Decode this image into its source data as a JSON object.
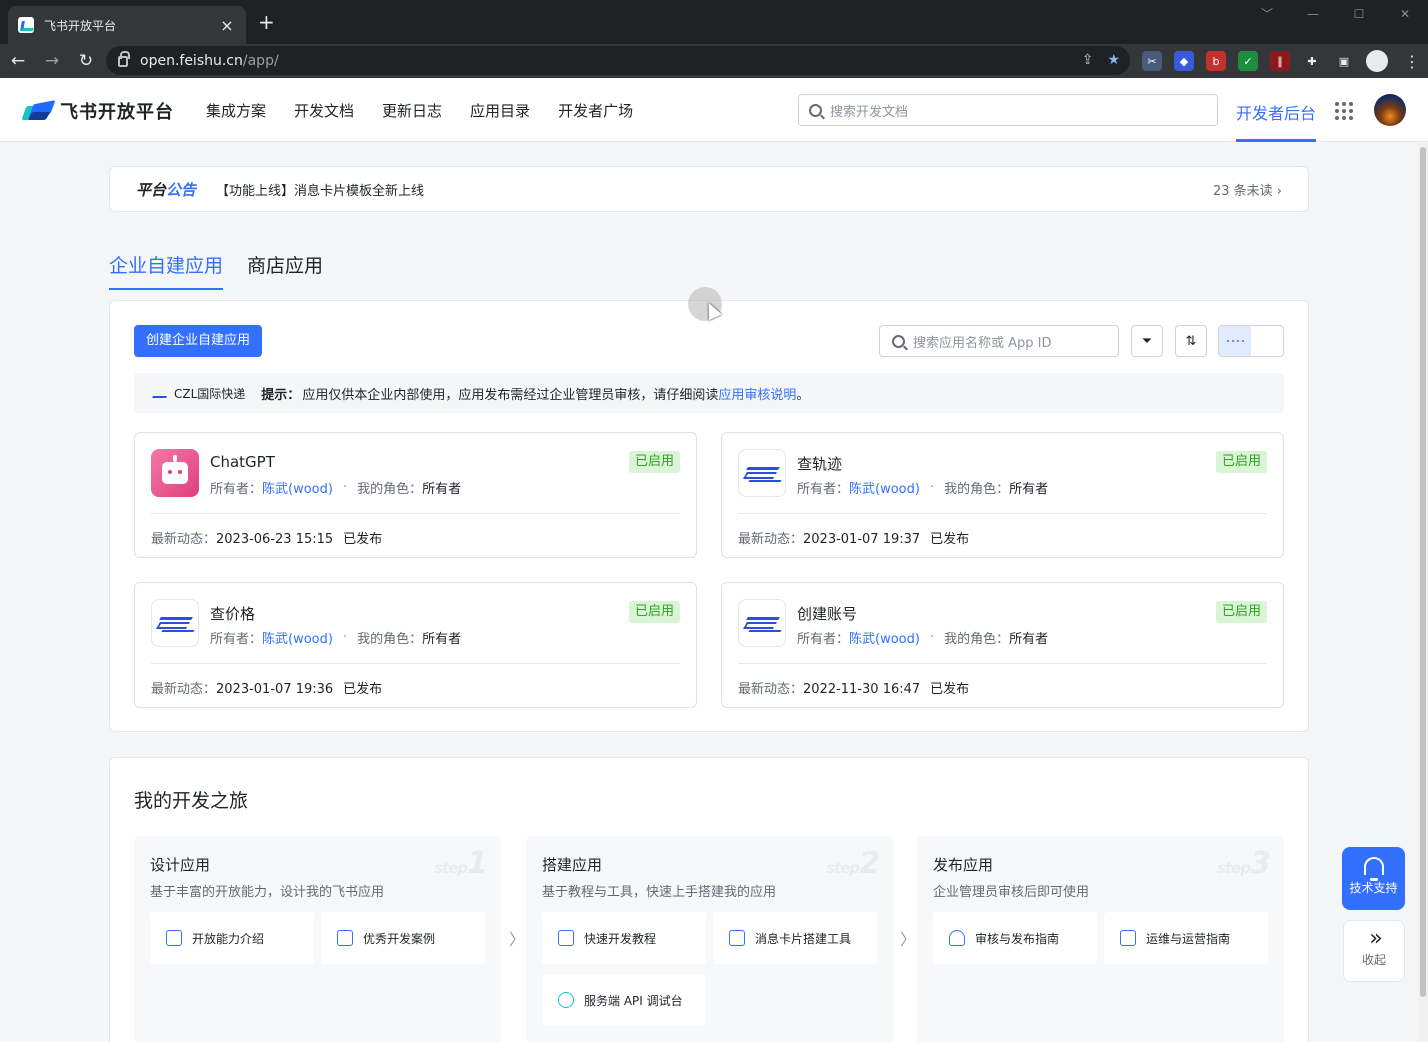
{
  "browser": {
    "tab_title": "飞书开放平台",
    "tab_close": "×",
    "new_tab": "+",
    "url_host": "open.feishu.cn",
    "url_path": "/app/",
    "window_controls": [
      "﹀",
      "—",
      "☐",
      "✕"
    ],
    "kebab": "⋮"
  },
  "header": {
    "logo_text": "飞书开放平台",
    "nav": [
      "集成方案",
      "开发文档",
      "更新日志",
      "应用目录",
      "开发者广场"
    ],
    "search_placeholder": "搜索开发文档",
    "dev_console": "开发者后台"
  },
  "notice": {
    "tag_a": "平台",
    "tag_b": "公告",
    "text": "【功能上线】消息卡片模板全新上线",
    "unread": "23 条未读 ›"
  },
  "tabs": [
    "企业自建应用",
    "商店应用"
  ],
  "apps": {
    "create_button": "创建企业自建应用",
    "search_placeholder": "搜索应用名称或 App ID",
    "tip_org": "CZL国际快递",
    "tip_label": "提示：",
    "tip_text": "应用仅供本企业内部使用，应用发布需经过企业管理员审核，请仔细阅读 ",
    "tip_link": "应用审核说明",
    "tip_end": "。",
    "owner_label": "所有者：",
    "role_label": "我的角色：",
    "dot": "·",
    "update_label": "最新动态：",
    "cards": [
      {
        "name": "ChatGPT",
        "status": "已启用",
        "owner": "陈武(wood)",
        "role": "所有者",
        "time": "2023-06-23 15:15",
        "state": "已发布"
      },
      {
        "name": "查轨迹",
        "status": "已启用",
        "owner": "陈武(wood)",
        "role": "所有者",
        "time": "2023-01-07 19:37",
        "state": "已发布"
      },
      {
        "name": "查价格",
        "status": "已启用",
        "owner": "陈武(wood)",
        "role": "所有者",
        "time": "2023-01-07 19:36",
        "state": "已发布"
      },
      {
        "name": "创建账号",
        "status": "已启用",
        "owner": "陈武(wood)",
        "role": "所有者",
        "time": "2022-11-30 16:47",
        "state": "已发布"
      }
    ]
  },
  "journey": {
    "title": "我的开发之旅",
    "steps": [
      {
        "title": "设计应用",
        "desc": "基于丰富的开放能力，设计我的飞书应用",
        "wm_word": "step",
        "wm_num": "1",
        "links": [
          "开放能力介绍",
          "优秀开发案例"
        ]
      },
      {
        "title": "搭建应用",
        "desc": "基于教程与工具，快速上手搭建我的应用",
        "wm_word": "step",
        "wm_num": "2",
        "links": [
          "快速开发教程",
          "消息卡片搭建工具",
          "服务端 API 调试台"
        ]
      },
      {
        "title": "发布应用",
        "desc": "企业管理员审核后即可使用",
        "wm_word": "step",
        "wm_num": "3",
        "links": [
          "审核与发布指南",
          "运维与运营指南"
        ]
      }
    ],
    "arrow": "〉"
  },
  "float": {
    "support": "技术支持",
    "collapse": "收起",
    "collapse_glyph": "»"
  },
  "colors": {
    "accent": "#3370ff",
    "success_bg": "#d9f5d6",
    "success_fg": "#2ea121"
  }
}
